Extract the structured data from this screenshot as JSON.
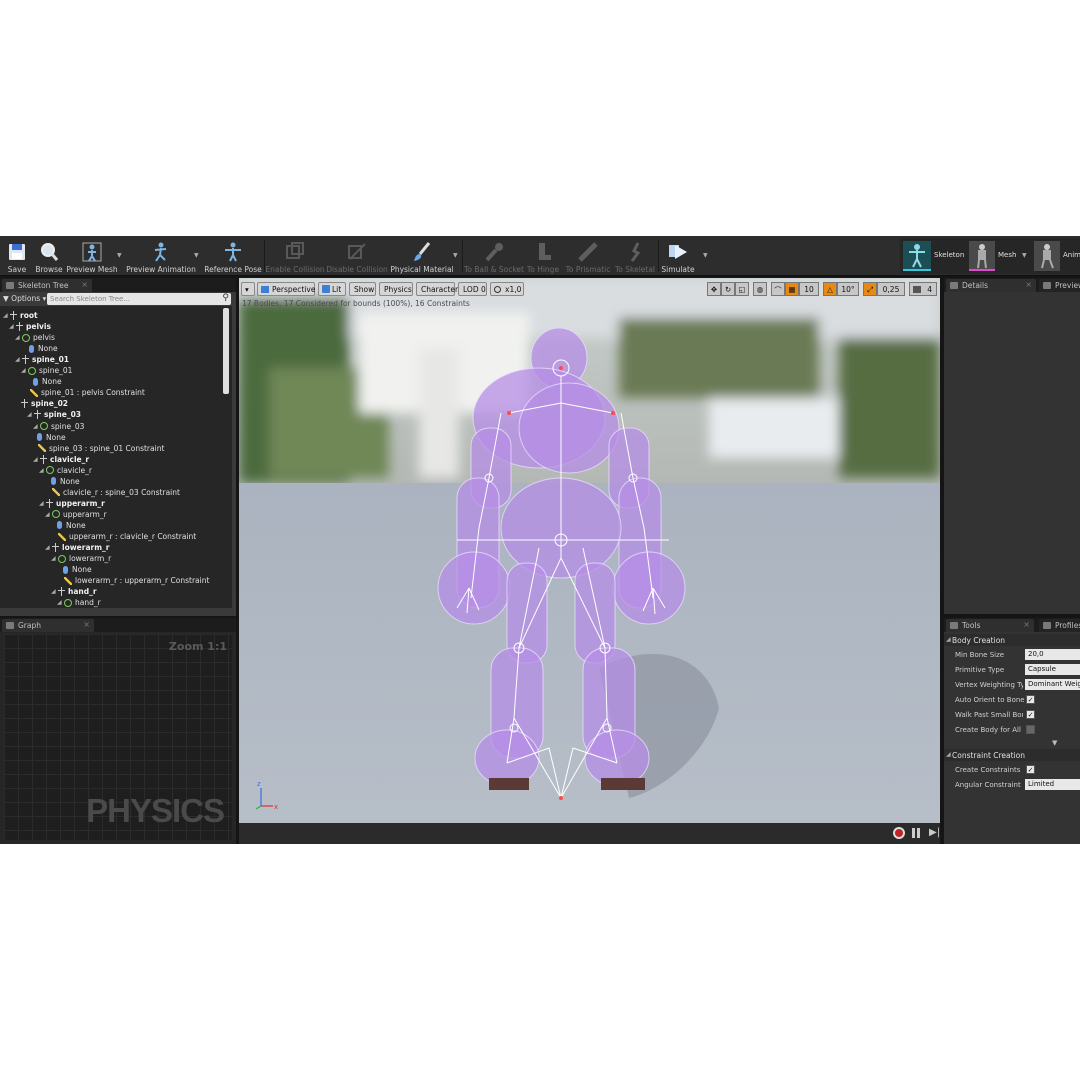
{
  "toolbar": {
    "buttons": [
      {
        "label": "Save"
      },
      {
        "label": "Browse"
      },
      {
        "label": "Preview Mesh"
      },
      {
        "label": "Preview Animation"
      },
      {
        "label": "Reference Pose"
      },
      {
        "label": "Enable Collision"
      },
      {
        "label": "Disable Collision"
      },
      {
        "label": "Physical Material"
      },
      {
        "label": "To Ball & Socket"
      },
      {
        "label": "To Hinge"
      },
      {
        "label": "To Prismatic"
      },
      {
        "label": "To Skeletal"
      },
      {
        "label": "Simulate"
      }
    ],
    "modes": [
      {
        "label": "Skeleton"
      },
      {
        "label": "Mesh"
      },
      {
        "label": "Anim"
      }
    ]
  },
  "skeleton_tree": {
    "tab": "Skeleton Tree",
    "options_label": "Options",
    "search_placeholder": "Search Skeleton Tree...",
    "rows": [
      {
        "text": "root",
        "kind": "bone"
      },
      {
        "text": "pelvis",
        "kind": "bone"
      },
      {
        "text": "pelvis",
        "kind": "body"
      },
      {
        "text": "None",
        "kind": "shape"
      },
      {
        "text": "spine_01",
        "kind": "bone"
      },
      {
        "text": "spine_01",
        "kind": "body"
      },
      {
        "text": "None",
        "kind": "shape"
      },
      {
        "text": "spine_01 : pelvis Constraint",
        "kind": "constraint"
      },
      {
        "text": "spine_02",
        "kind": "bone"
      },
      {
        "text": "spine_03",
        "kind": "bone"
      },
      {
        "text": "spine_03",
        "kind": "body"
      },
      {
        "text": "None",
        "kind": "shape"
      },
      {
        "text": "spine_03 : spine_01 Constraint",
        "kind": "constraint"
      },
      {
        "text": "clavicle_r",
        "kind": "bone"
      },
      {
        "text": "clavicle_r",
        "kind": "body"
      },
      {
        "text": "None",
        "kind": "shape"
      },
      {
        "text": "clavicle_r : spine_03 Constraint",
        "kind": "constraint"
      },
      {
        "text": "upperarm_r",
        "kind": "bone"
      },
      {
        "text": "upperarm_r",
        "kind": "body"
      },
      {
        "text": "None",
        "kind": "shape"
      },
      {
        "text": "upperarm_r : clavicle_r Constraint",
        "kind": "constraint"
      },
      {
        "text": "lowerarm_r",
        "kind": "bone"
      },
      {
        "text": "lowerarm_r",
        "kind": "body"
      },
      {
        "text": "None",
        "kind": "shape"
      },
      {
        "text": "lowerarm_r : upperarm_r Constraint",
        "kind": "constraint"
      },
      {
        "text": "hand_r",
        "kind": "bone"
      },
      {
        "text": "hand_r",
        "kind": "body"
      }
    ]
  },
  "graph": {
    "tab": "Graph",
    "zoom": "Zoom 1:1",
    "watermark": "PHYSICS"
  },
  "viewport": {
    "buttons": [
      "Perspective",
      "Lit",
      "Show",
      "Physics",
      "Character",
      "LOD 0",
      "x1,0"
    ],
    "stats": "17 Bodies, 17 Considered for bounds (100%), 16 Constraints",
    "snap_grid": "10",
    "snap_rot": "10°",
    "snap_scale": "0,25",
    "camera_speed": "4"
  },
  "details": {
    "tabs": [
      "Details",
      "Preview"
    ]
  },
  "tools": {
    "tabs": [
      "Tools",
      "Profiles"
    ],
    "body_creation": {
      "title": "Body Creation",
      "min_bone_size_label": "Min Bone Size",
      "min_bone_size": "20,0",
      "primitive_type_label": "Primitive Type",
      "primitive_type": "Capsule",
      "vertex_weighting_label": "Vertex Weighting Type",
      "vertex_weighting": "Dominant Weight",
      "auto_orient_label": "Auto Orient to Bone",
      "walk_past_label": "Walk Past Small Bones",
      "create_all_label": "Create Body for All Bones"
    },
    "constraint_creation": {
      "title": "Constraint Creation",
      "create_constraints_label": "Create Constraints",
      "angular_mode_label": "Angular Constraint Mode",
      "angular_mode": "Limited"
    }
  }
}
